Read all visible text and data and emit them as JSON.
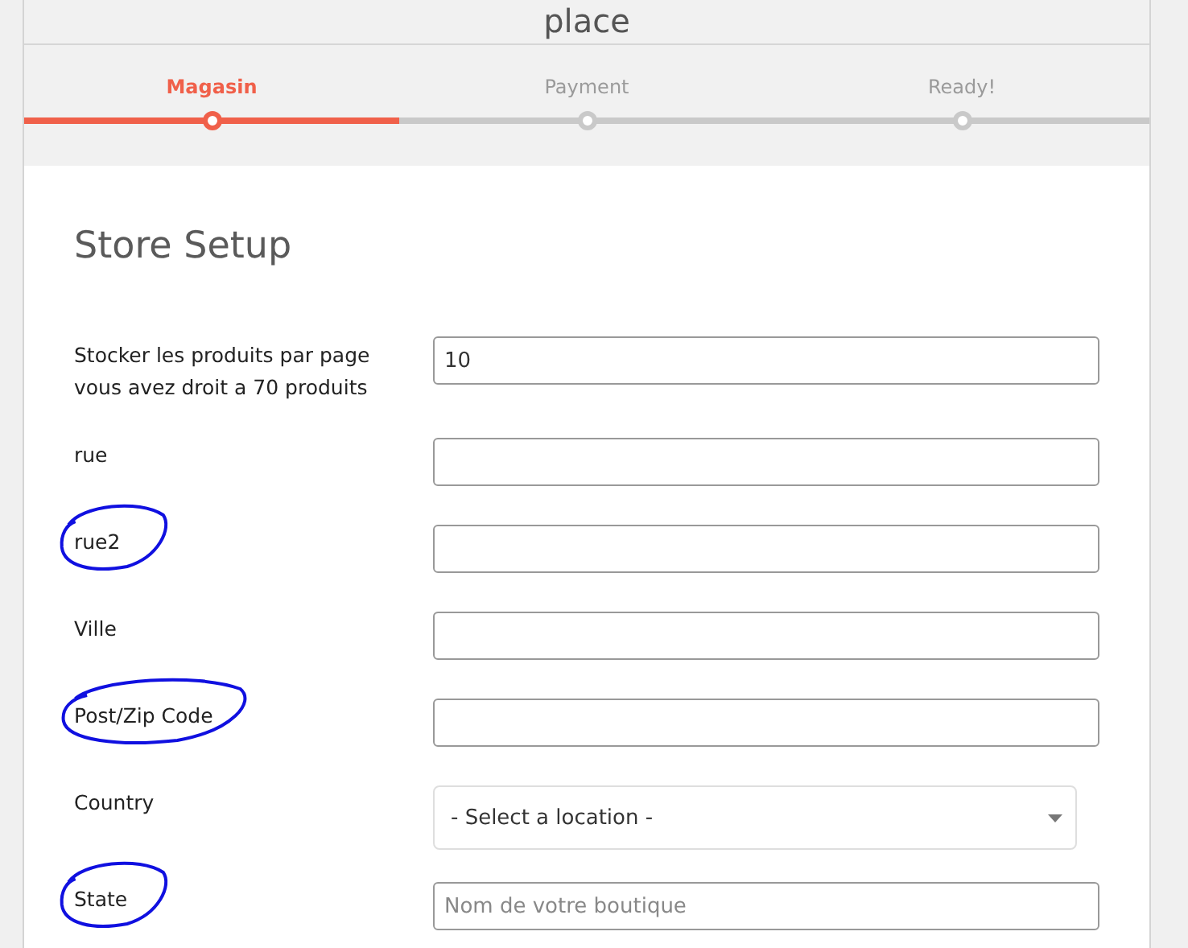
{
  "header": {
    "title": "place"
  },
  "steps": [
    {
      "label": "Magasin",
      "selected": true
    },
    {
      "label": "Payment",
      "selected": false
    },
    {
      "label": "Ready!",
      "selected": false
    }
  ],
  "form": {
    "title": "Store Setup",
    "fields": [
      {
        "kind": "text",
        "label": "Stocker les produits par page",
        "hint": "vous avez droit a 70 produits",
        "value": "10",
        "circled": false
      },
      {
        "kind": "text",
        "label": "rue",
        "circled": false
      },
      {
        "kind": "text",
        "label": "rue2",
        "circled": true
      },
      {
        "kind": "text",
        "label": "Ville",
        "circled": false
      },
      {
        "kind": "text",
        "label": "Post/Zip Code",
        "circled": true
      },
      {
        "kind": "select",
        "label": "Country",
        "value": "- Select a location -",
        "circled": false
      },
      {
        "kind": "text",
        "label": "State",
        "placeholder": "Nom de votre boutique",
        "circled": true
      }
    ]
  }
}
